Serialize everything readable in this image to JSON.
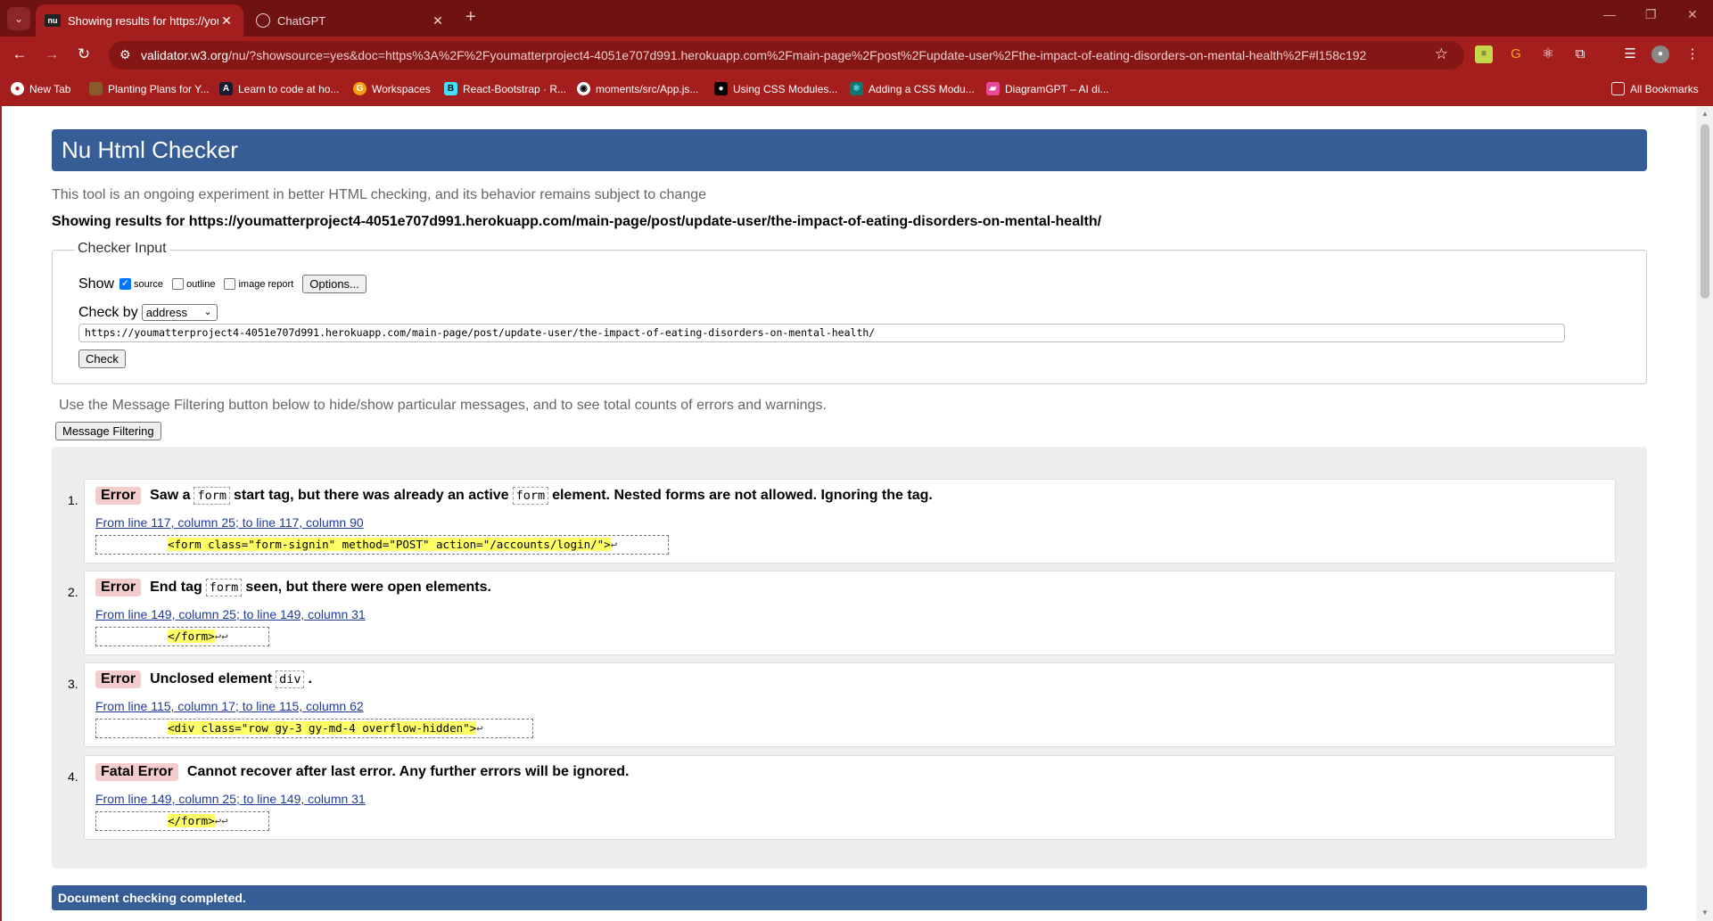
{
  "browser": {
    "tabs": [
      {
        "label": "Showing results for https://youmatter",
        "favicon": "nu"
      },
      {
        "label": "ChatGPT",
        "favicon": ""
      }
    ],
    "url_host": "validator.w3.org",
    "url_rest": "/nu/?showsource=yes&doc=https%3A%2F%2Fyoumatterproject4-4051e707d991.herokuapp.com%2Fmain-page%2Fpost%2Fupdate-user%2Fthe-impact-of-eating-disorders-on-mental-health%2F#l158c192",
    "bookmarks": [
      {
        "label": "New Tab"
      },
      {
        "label": "Planting Plans for Y..."
      },
      {
        "label": "Learn to code at ho..."
      },
      {
        "label": "Workspaces"
      },
      {
        "label": "React-Bootstrap · R..."
      },
      {
        "label": "moments/src/App.js..."
      },
      {
        "label": "Using CSS Modules..."
      },
      {
        "label": "Adding a CSS Modu..."
      },
      {
        "label": "DiagramGPT – AI di..."
      }
    ],
    "all_bookmarks": "All Bookmarks",
    "theme": {
      "tabbar": "#6e1212",
      "toolbar": "#a51e1e",
      "omnibox": "#851616"
    }
  },
  "page": {
    "title": "Nu Html Checker",
    "intro": "This tool is an ongoing experiment in better HTML checking, and its behavior remains subject to change",
    "showing": "Showing results for https://youmatterproject4-4051e707d991.herokuapp.com/main-page/post/update-user/the-impact-of-eating-disorders-on-mental-health/",
    "checker_input_legend": "Checker Input",
    "show_label": "Show",
    "checkboxes": [
      {
        "label": "source",
        "checked": true
      },
      {
        "label": "outline",
        "checked": false
      },
      {
        "label": "image report",
        "checked": false
      }
    ],
    "options_button": "Options...",
    "check_by_label": "Check by",
    "check_by_value": "address",
    "address_value": "https://youmatterproject4-4051e707d991.herokuapp.com/main-page/post/update-user/the-impact-of-eating-disorders-on-mental-health/",
    "check_button": "Check",
    "filter_info": "Use the Message Filtering button below to hide/show particular messages, and to see total counts of errors and warnings.",
    "filter_button": "Message Filtering",
    "messages": [
      {
        "num": "1.",
        "type": "Error",
        "parts": [
          "Saw a",
          "form",
          "start tag, but there was already an active",
          "form",
          "element. Nested forms are not allowed. Ignoring the tag."
        ],
        "location": "From line 117, column 25; to line 117, column 90",
        "extract": "<form class=\"form-signin\" method=\"POST\" action=\"/accounts/login/\">",
        "returns": "↩"
      },
      {
        "num": "2.",
        "type": "Error",
        "parts": [
          "End tag",
          "form",
          "seen, but there were open elements."
        ],
        "location": "From line 149, column 25; to line 149, column 31",
        "extract": "</form>",
        "returns": "↩↩"
      },
      {
        "num": "3.",
        "type": "Error",
        "parts": [
          "Unclosed element",
          "div",
          "."
        ],
        "location": "From line 115, column 17; to line 115, column 62",
        "extract": "<div class=\"row gy-3 gy-md-4 overflow-hidden\">",
        "returns": "↩"
      },
      {
        "num": "4.",
        "type": "Fatal Error",
        "parts": [
          "Cannot recover after last error. Any further errors will be ignored."
        ],
        "location": "From line 149, column 25; to line 149, column 31",
        "extract": "</form>",
        "returns": "↩↩"
      }
    ],
    "footer": "Document checking completed.",
    "colors": {
      "header": "#365d95",
      "error_badge": "#f4cccc",
      "highlight": "#ffff66",
      "link": "#1f3a9a"
    }
  }
}
